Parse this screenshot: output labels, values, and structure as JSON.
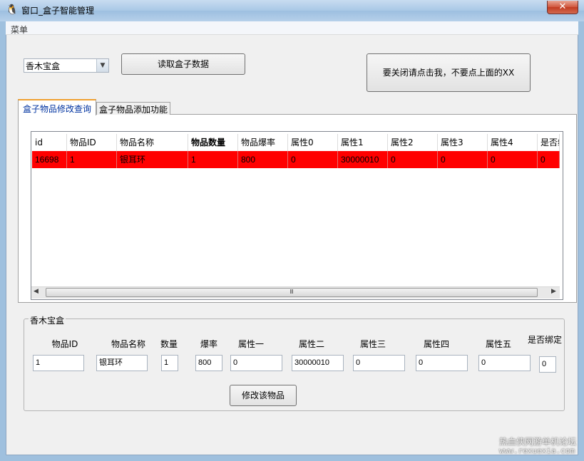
{
  "window": {
    "title": "窗口_盒子智能管理",
    "close_label": "✕"
  },
  "menu": {
    "label": "菜单"
  },
  "toolbar": {
    "combo_value": "香木宝盒",
    "read_button": "读取盒子数据",
    "exit_button": "要关闭请点击我，不要点上面的XX"
  },
  "tabs": [
    {
      "label": "盒子物品修改查询"
    },
    {
      "label": "盒子物品添加功能"
    }
  ],
  "grid": {
    "columns": [
      "id",
      "物品ID",
      "物品名称",
      "物品数量",
      "物品爆率",
      "属性0",
      "属性1",
      "属性2",
      "属性3",
      "属性4",
      "是否绑"
    ],
    "rows": [
      [
        "16698",
        "1",
        "银耳环",
        "1",
        "800",
        "0",
        "30000010",
        "0",
        "0",
        "0",
        "0"
      ]
    ],
    "scroll_thumb": "Ⅲ"
  },
  "editor": {
    "group_title": "香木宝盒",
    "labels": [
      "物品ID",
      "物品名称",
      "数量",
      "爆率",
      "属性一",
      "属性二",
      "属性三",
      "属性四",
      "属性五",
      "是否绑定"
    ],
    "values": [
      "1",
      "银耳环",
      "1",
      "800",
      "0",
      "30000010",
      "0",
      "0",
      "0",
      "0"
    ],
    "modify_button": "修改该物品"
  },
  "watermark": {
    "text": "热血侠网游单机论坛",
    "url": "www.rexuexia.com"
  }
}
